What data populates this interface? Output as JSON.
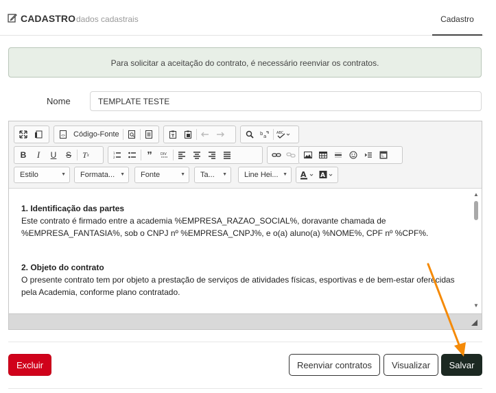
{
  "header": {
    "title": "CADASTRO",
    "subtitle": "dados cadastrais",
    "tab_label": "Cadastro"
  },
  "alert": {
    "message": "Para solicitar a aceitação do contrato, é necessário reenviar os contratos."
  },
  "form": {
    "name_label": "Nome",
    "name_value": "TEMPLATE TESTE"
  },
  "editor": {
    "source_label": "Código-Fonte",
    "combos": {
      "style": "Estilo",
      "format": "Formata...",
      "font": "Fonte",
      "size": "Ta...",
      "line_height": "Line Hei..."
    },
    "content": {
      "heading1": "1. Identificação das partes",
      "para1_line1": "Este contrato é firmado entre a academia %EMPRESA_RAZAO_SOCIAL%, doravante chamada de",
      "para1_line2": "%EMPRESA_FANTASIA%, sob o CNPJ nº  %EMPRESA_CNPJ%, e o(a) aluno(a) %NOME%, CPF nº %CPF%.",
      "heading2": "2. Objeto do contrato",
      "para2_line1": "O presente contrato tem por objeto a prestação de serviços de atividades físicas, esportivas e de bem-estar oferecidas",
      "para2_line2": "pela Academia, conforme plano contratado."
    }
  },
  "actions": {
    "delete_label": "Excluir",
    "resend_label": "Reenviar contratos",
    "preview_label": "Visualizar",
    "save_label": "Salvar"
  },
  "colors": {
    "danger": "#d0021b",
    "primary_dark": "#1c2922",
    "alert_bg": "#e8efe7",
    "annotation_arrow": "#f58a07"
  }
}
